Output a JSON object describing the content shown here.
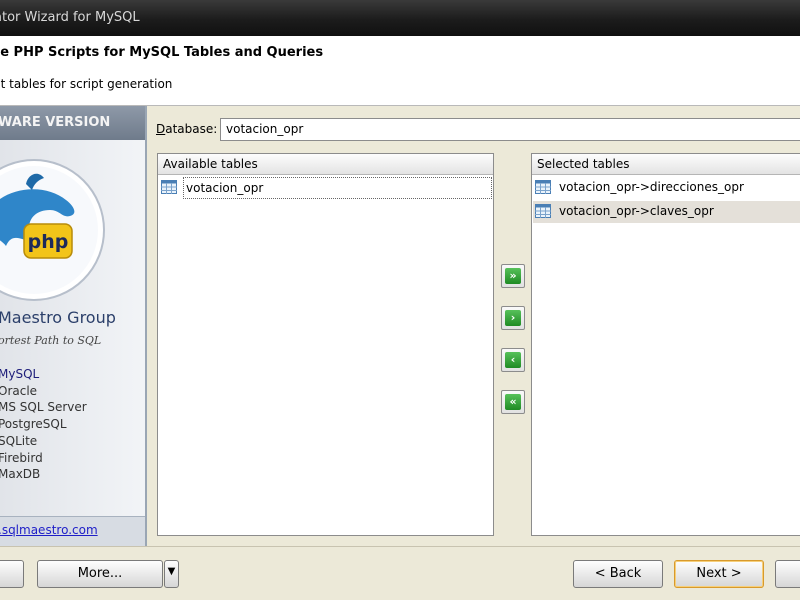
{
  "window": {
    "title": "ator Wizard for MySQL"
  },
  "header": {
    "title": "te PHP Scripts for MySQL Tables and Queries",
    "subtitle": "ct tables for script generation"
  },
  "sidebar": {
    "banner": "WARE VERSION",
    "brand": "Maestro Group",
    "tagline": "ortest Path to SQL",
    "items": [
      "MySQL",
      "Oracle",
      "MS SQL Server",
      "PostgreSQL",
      "SQLite",
      "Firebird",
      "MaxDB"
    ],
    "link": ".sqlmaestro.com",
    "logo_text": "php"
  },
  "database": {
    "label_prefix": "D",
    "label_rest": "atabase:",
    "value": "votacion_opr"
  },
  "available": {
    "header": "Available tables",
    "items": [
      "votacion_opr"
    ]
  },
  "selected": {
    "header": "Selected tables",
    "items": [
      "votacion_opr->direcciones_opr",
      "votacion_opr->claves_opr"
    ]
  },
  "move_buttons": {
    "add_all": "»",
    "add": "›",
    "remove": "‹",
    "remove_all": "«"
  },
  "buttons": {
    "more": "More...",
    "back": "< Back",
    "next": "Next >"
  },
  "colors": {
    "titlebar": "#1c1c1c",
    "banner": "#7f8a99",
    "move_green": "#2e9b32",
    "default_border": "#d89a2c"
  }
}
